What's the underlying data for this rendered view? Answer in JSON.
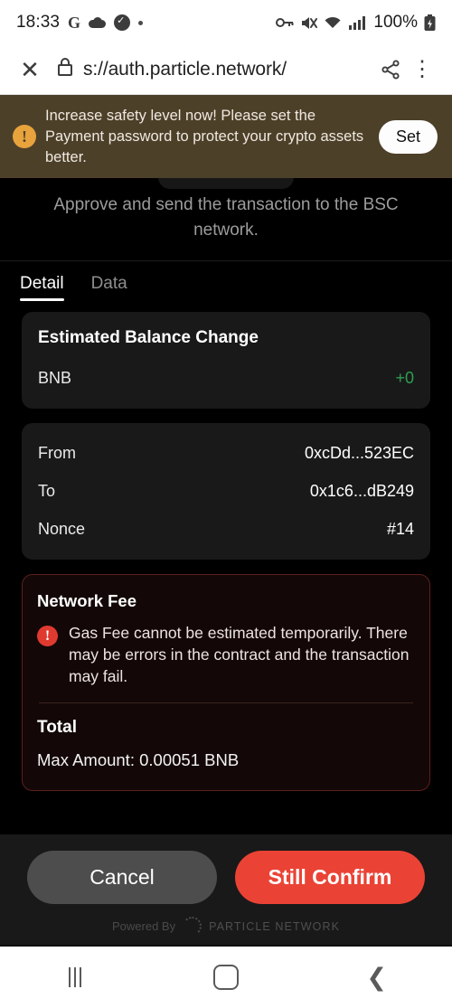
{
  "status_bar": {
    "time": "18:33",
    "left_icons": [
      "google-icon",
      "cloud-icon",
      "watch-icon",
      "dot-icon"
    ],
    "right_icons": [
      "vpn-key-icon",
      "mute-icon",
      "wifi-icon",
      "signal-icon"
    ],
    "battery_percent": "100%",
    "battery_icon": "battery-charging-icon"
  },
  "browser": {
    "close_icon": "close-icon",
    "lock_icon": "lock-icon",
    "url": "s://auth.particle.network/",
    "share_icon": "share-icon",
    "menu_icon": "more-vertical-icon"
  },
  "banner": {
    "icon": "warning-exclamation-icon",
    "message": "Increase safety level now! Please set the Payment password to protect your crypto assets better.",
    "action_label": "Set",
    "background_color": "#4d4029",
    "icon_color": "#e8a33d"
  },
  "app": {
    "description": "Approve and send the transaction to the BSC network.",
    "tabs": [
      {
        "label": "Detail",
        "active": true
      },
      {
        "label": "Data",
        "active": false
      }
    ],
    "balance_card": {
      "title": "Estimated Balance Change",
      "rows": [
        {
          "label": "BNB",
          "value": "+0",
          "value_color": "#2e9e52"
        }
      ]
    },
    "details_card": {
      "rows": [
        {
          "label": "From",
          "value": "0xcDd...523EC"
        },
        {
          "label": "To",
          "value": "0x1c6...dB249"
        },
        {
          "label": "Nonce",
          "value": "#14"
        }
      ]
    },
    "fee_card": {
      "title": "Network Fee",
      "alert_icon": "error-exclamation-icon",
      "alert_color": "#e03a30",
      "alert_text": "Gas Fee cannot be estimated temporarily. There may be errors in the contract and the transaction may fail.",
      "total_title": "Total",
      "total_value": "Max Amount: 0.00051 BNB",
      "border_color": "#5d1f1c"
    },
    "footer": {
      "cancel_label": "Cancel",
      "confirm_label": "Still Confirm",
      "confirm_color": "#ea4335",
      "powered_by": "Powered By",
      "brand": "PARTICLE NETWORK",
      "brand_icon": "particle-swirl-icon"
    }
  },
  "nav_bar": {
    "recents_icon": "recents-icon",
    "home_icon": "home-icon",
    "back_icon": "back-chevron-icon"
  }
}
